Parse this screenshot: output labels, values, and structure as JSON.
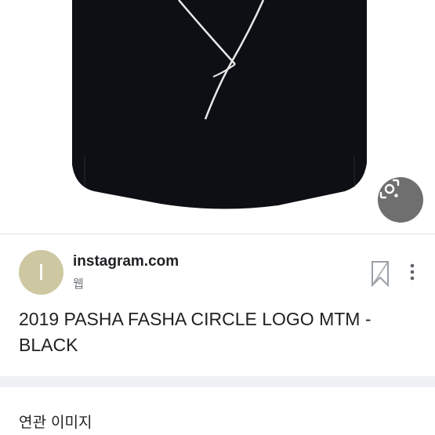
{
  "result": {
    "image_icon": "sweater-photo",
    "lens_icon": "lens-search-icon",
    "source_initial": "I",
    "source_name": "instagram.com",
    "source_type": "웹",
    "title": "2019 PASHA FASHA CIRCLE LOGO MTM - BLACK"
  },
  "related": {
    "title": "연관 이미지"
  },
  "colors": {
    "avatar": "#cdc8a2",
    "lens_button": "#6f6f6f",
    "divider": "#eef0f3",
    "garment": "#0d0f14"
  }
}
